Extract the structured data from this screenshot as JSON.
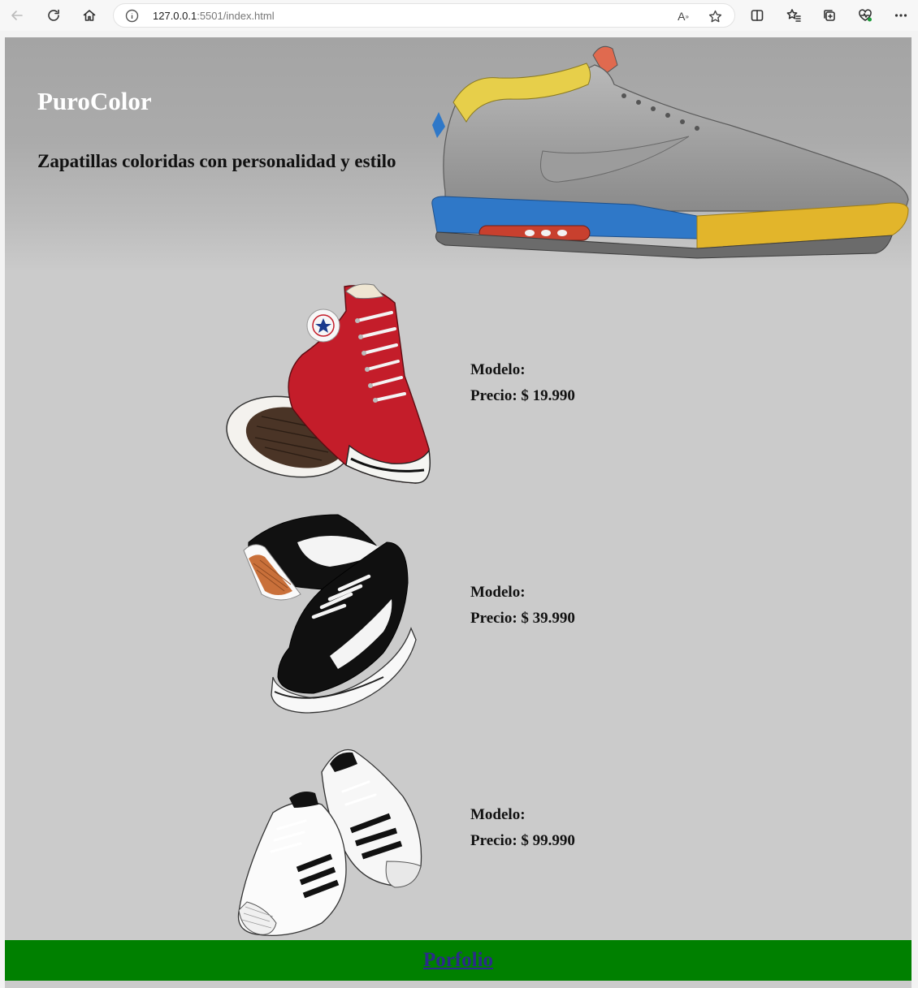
{
  "browser": {
    "url_host": "127.0.0.1",
    "url_rest": ":5501/index.html"
  },
  "header": {
    "title": "PuroColor",
    "tagline": "Zapatillas coloridas con personalidad y estilo"
  },
  "products": [
    {
      "image": "red-high-top-sneaker",
      "model_label": "Modelo:",
      "price_label": "Precio: $ 19.990"
    },
    {
      "image": "black-low-top-sneaker",
      "model_label": "Modelo:",
      "price_label": "Precio: $ 39.990"
    },
    {
      "image": "white-striped-sneaker",
      "model_label": "Modelo:",
      "price_label": "Precio: $ 99.990"
    }
  ],
  "footer": {
    "link_label": "Porfolio"
  }
}
